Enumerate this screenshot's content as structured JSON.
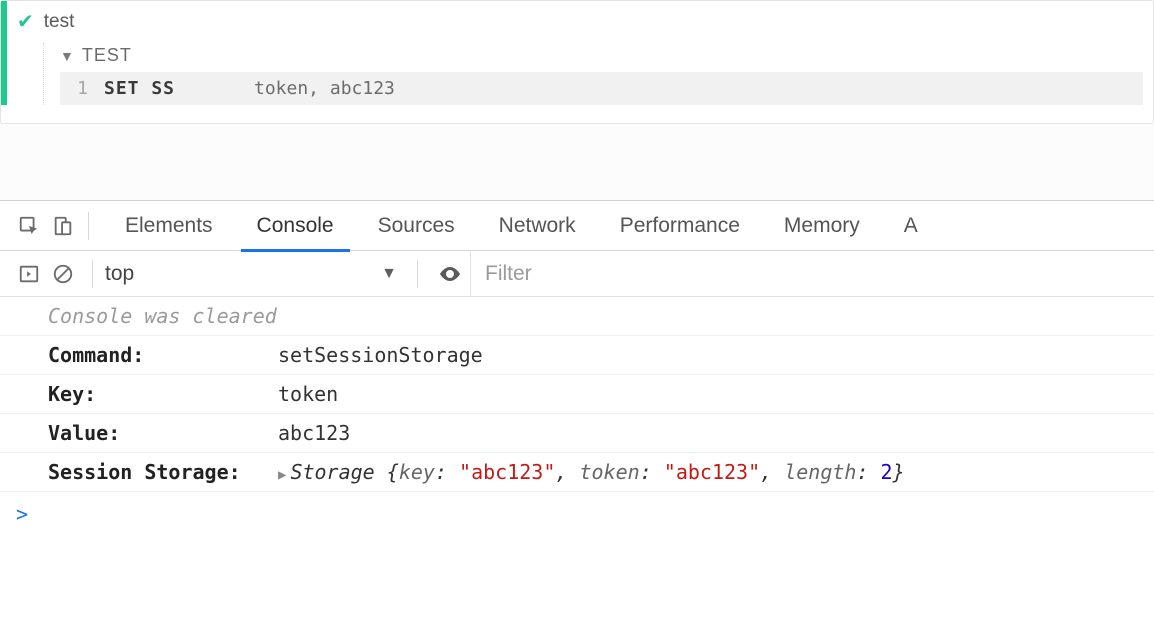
{
  "runner": {
    "title": "test",
    "block_label": "TEST",
    "command": {
      "lineno": "1",
      "name": "SET SS",
      "args": "token, abc123"
    }
  },
  "devtools_tabs": {
    "elements": "Elements",
    "console": "Console",
    "sources": "Sources",
    "network": "Network",
    "performance": "Performance",
    "memory": "Memory",
    "overflow": "A"
  },
  "toolbar": {
    "context": "top",
    "filter_placeholder": "Filter"
  },
  "console": {
    "cleared": "Console was cleared",
    "rows": {
      "command": {
        "label": "Command:",
        "value": "setSessionStorage"
      },
      "key": {
        "label": "Key:",
        "value": "token"
      },
      "value": {
        "label": "Value:",
        "value": "abc123"
      }
    },
    "storage": {
      "label": "Session Storage:",
      "type": "Storage",
      "k1": "key",
      "v1": "\"abc123\"",
      "k2": "token",
      "v2": "\"abc123\"",
      "k3": "length",
      "v3": "2"
    },
    "prompt": ">"
  }
}
